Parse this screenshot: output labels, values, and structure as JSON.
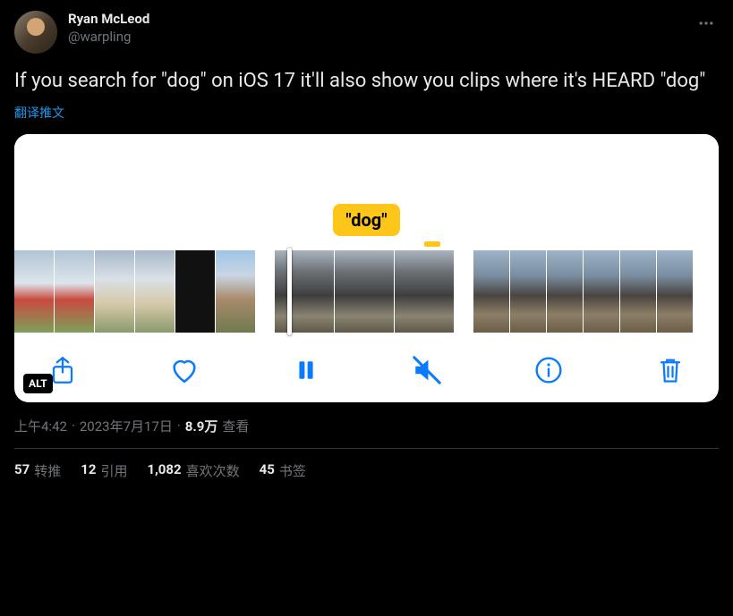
{
  "user": {
    "display_name": "Ryan McLeod",
    "handle": "@warpling"
  },
  "tweet": {
    "text": "If you search for \"dog\" on iOS 17 it'll also show you clips where it's HEARD \"dog\"",
    "translate_label": "翻译推文"
  },
  "media": {
    "bubble_text": "\"dog\"",
    "alt_badge": "ALT"
  },
  "meta": {
    "time": "上午4:42",
    "dot1": "·",
    "date": "2023年7月17日",
    "dot2": "·",
    "views_count": "8.9万",
    "views_label": "查看"
  },
  "stats": {
    "retweets": {
      "count": "57",
      "label": "转推"
    },
    "quotes": {
      "count": "12",
      "label": "引用"
    },
    "likes": {
      "count": "1,082",
      "label": "喜欢次数"
    },
    "bookmarks": {
      "count": "45",
      "label": "书签"
    }
  }
}
